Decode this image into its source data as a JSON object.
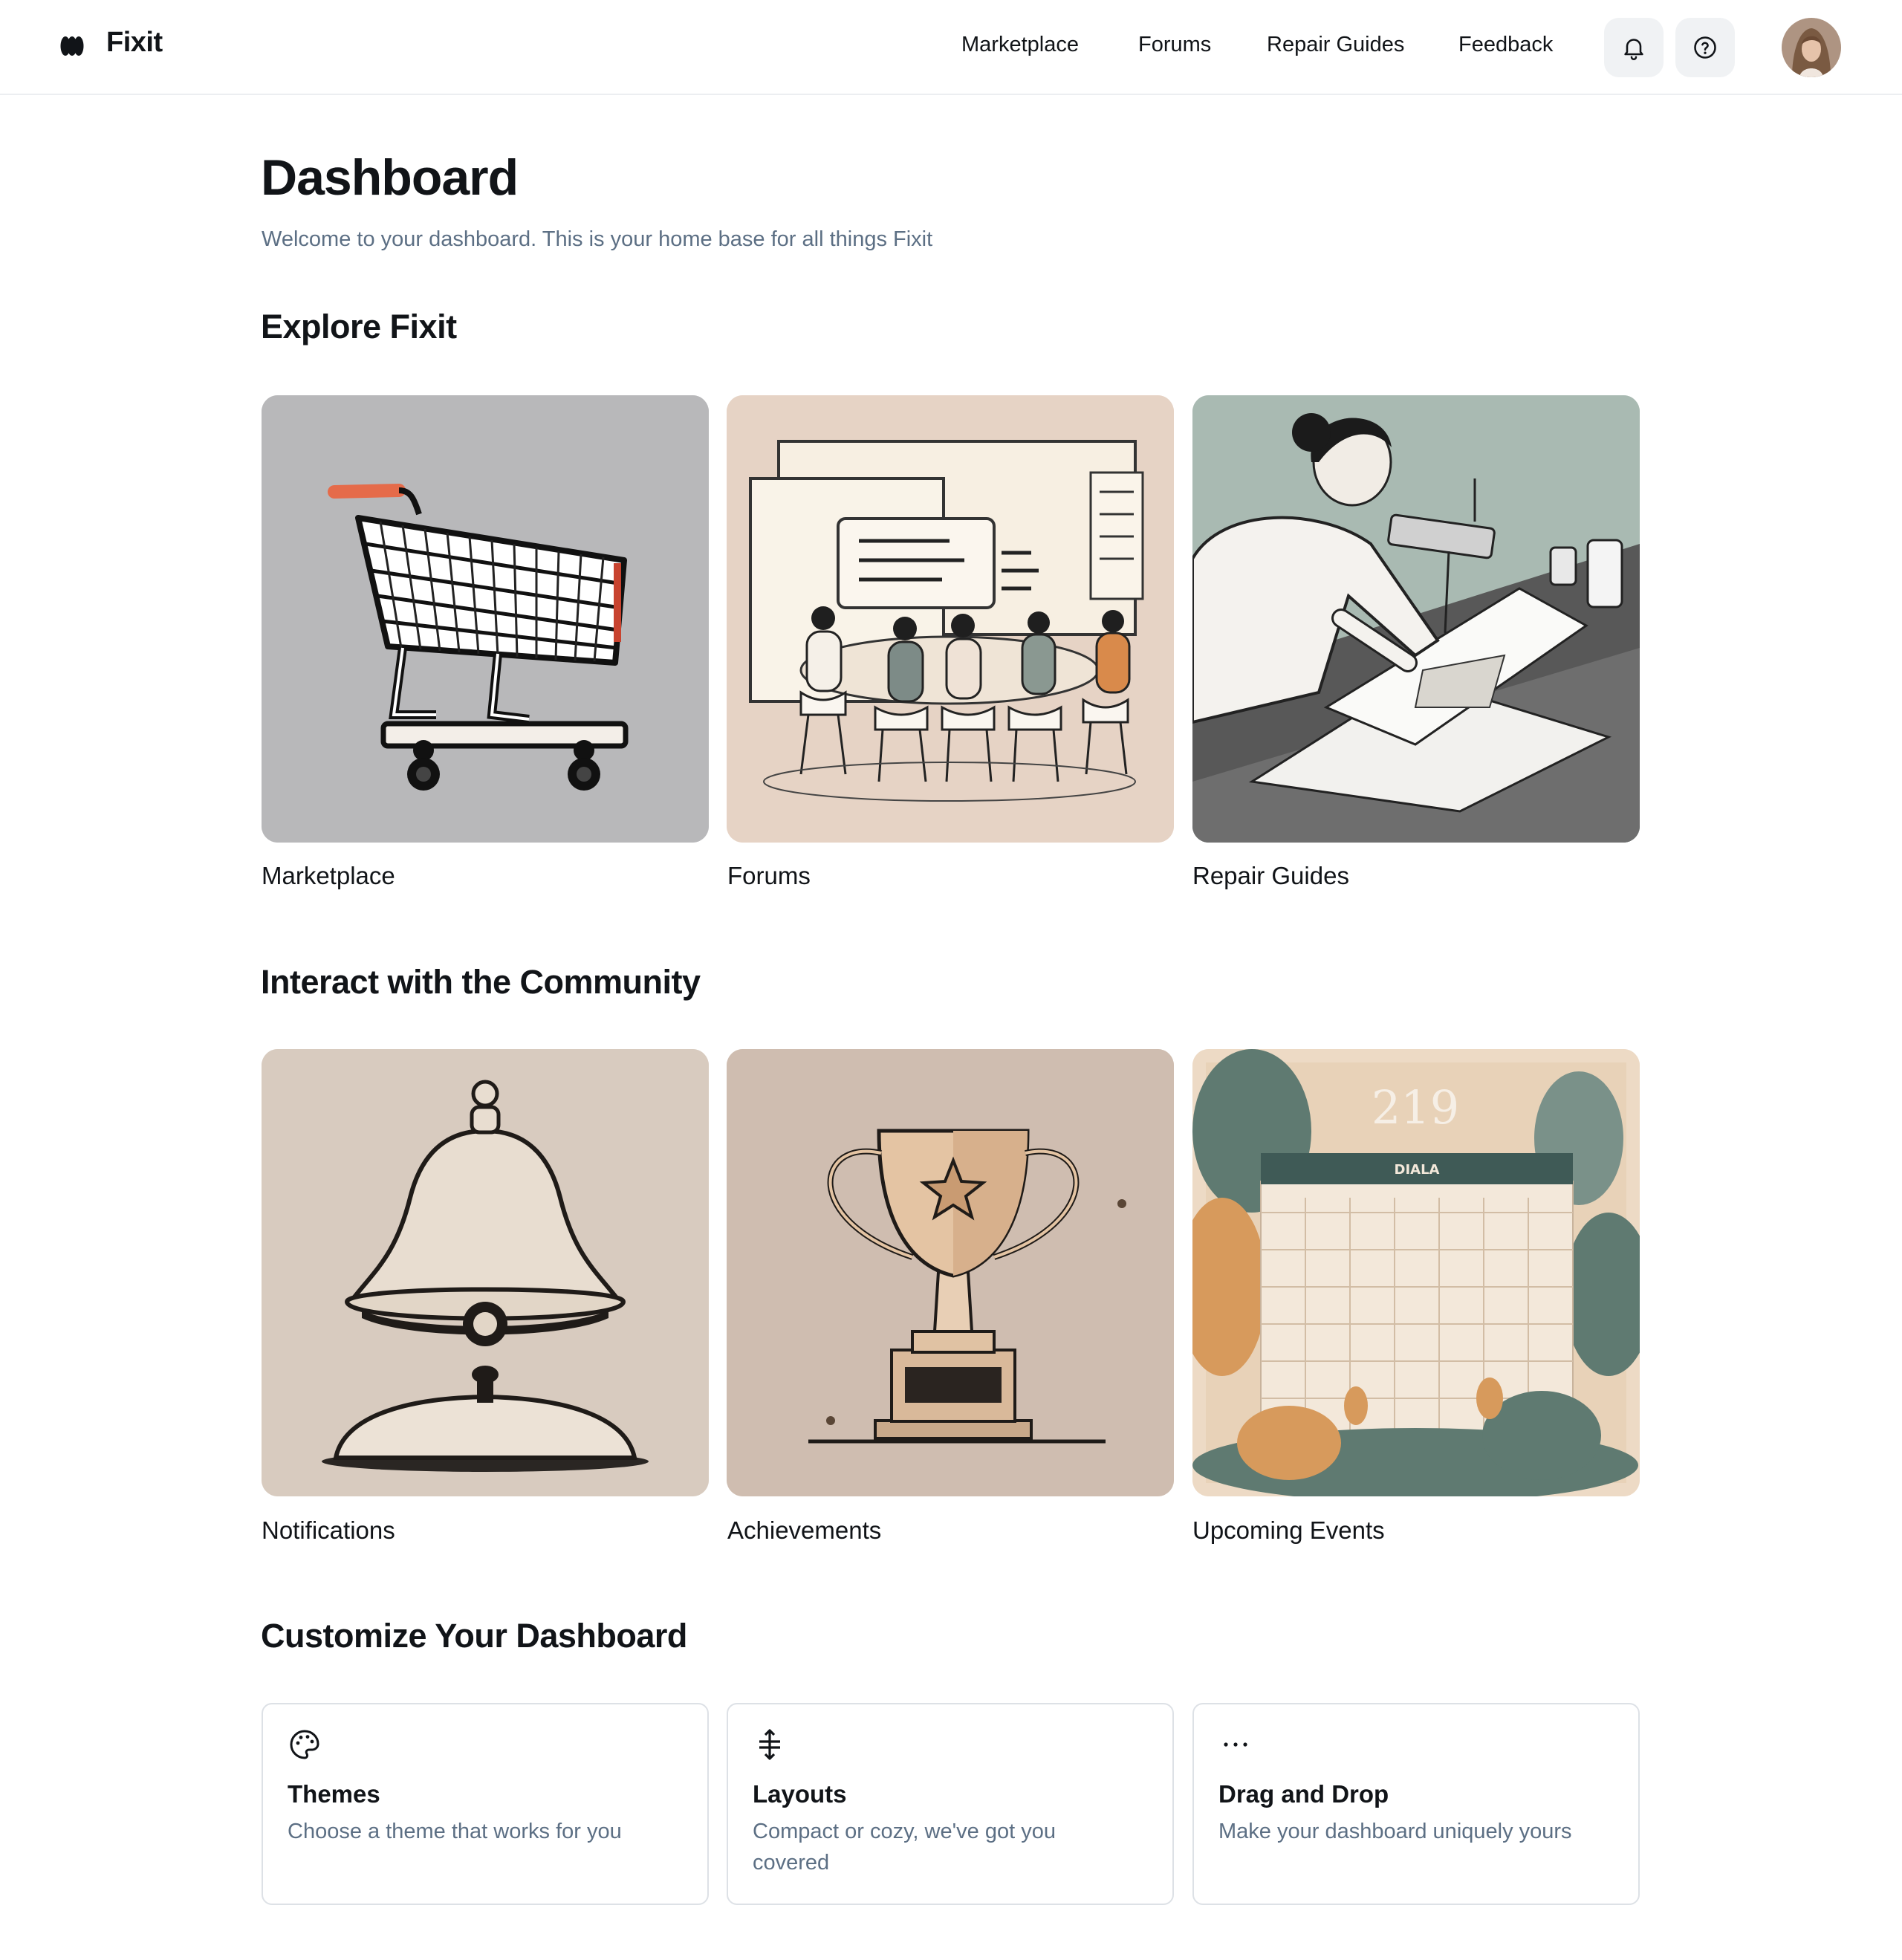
{
  "app": {
    "brand": "Fixit"
  },
  "nav": {
    "links": [
      "Marketplace",
      "Forums",
      "Repair Guides",
      "Feedback"
    ],
    "icons": [
      "bell-icon",
      "help-circle-icon"
    ]
  },
  "main": {
    "title": "Dashboard",
    "subtitle": "Welcome to your dashboard. This is your home base for all things Fixit",
    "sections": {
      "explore": {
        "title": "Explore Fixit",
        "tiles": [
          "Marketplace",
          "Forums",
          "Repair Guides"
        ]
      },
      "community": {
        "title": "Interact with the Community",
        "tiles": [
          "Notifications",
          "Achievements",
          "Upcoming Events"
        ]
      },
      "customize": {
        "title": "Customize Your Dashboard",
        "cards": [
          {
            "title": "Themes",
            "description": "Choose a theme that works for you",
            "icon": "palette-icon"
          },
          {
            "title": "Layouts",
            "description": "Compact or cozy, we've got you covered",
            "icon": "vertical-expand-icon"
          },
          {
            "title": "Drag and Drop",
            "description": "Make your dashboard uniquely yours",
            "icon": "more-horizontal-icon"
          }
        ]
      }
    }
  },
  "illustrations": {
    "calendar_heading": "DIALA",
    "calendar_year": "219"
  },
  "colors": {
    "text_primary": "#111418",
    "text_secondary": "#5c6f84",
    "icon_button_bg": "#f0f2f4",
    "card_border": "#dde1e6"
  }
}
